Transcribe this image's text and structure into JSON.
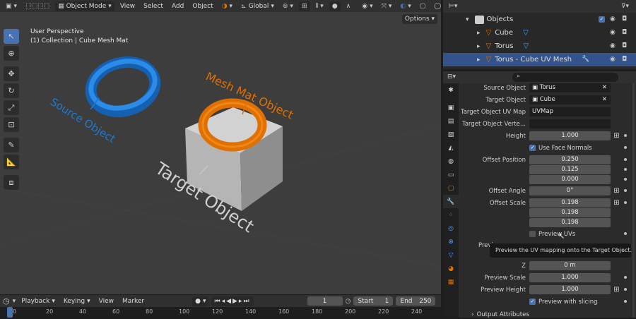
{
  "viewport_header": {
    "mode": "Object Mode",
    "menu": [
      "View",
      "Select",
      "Add",
      "Object"
    ],
    "orientation": "Global",
    "options": "Options"
  },
  "viewport": {
    "perspective": "User Perspective",
    "collection": "(1) Collection | Cube Mesh Mat",
    "labels": {
      "source": "Source Object",
      "mesh_mat": "Mesh Mat Object",
      "target": "Target Object"
    }
  },
  "outliner": {
    "title": "Objects",
    "items": [
      {
        "name": "Cube",
        "selected": false
      },
      {
        "name": "Torus",
        "selected": false
      },
      {
        "name": "Torus - Cube UV Mesh",
        "selected": true
      }
    ]
  },
  "properties": {
    "source_object": {
      "label": "Source Object",
      "value": "Torus"
    },
    "target_object": {
      "label": "Target Object",
      "value": "Cube"
    },
    "target_uv_map": {
      "label": "Target Object UV Map",
      "value": "UVMap"
    },
    "target_vertex": {
      "label": "Target Object Verte...",
      "value": ""
    },
    "height": {
      "label": "Height",
      "value": "1.000"
    },
    "use_face_normals": {
      "label": "Use Face Normals",
      "checked": true
    },
    "offset_position": {
      "label": "Offset Position",
      "values": [
        "0.250",
        "0.125",
        "0.000"
      ]
    },
    "offset_angle": {
      "label": "Offset Angle",
      "value": "0°"
    },
    "offset_scale": {
      "label": "Offset Scale",
      "values": [
        "0.198",
        "0.198",
        "0.198"
      ]
    },
    "preview_uvs": {
      "label": "Preview UVs",
      "checked": false
    },
    "preview_label_partial": "Previ",
    "z": {
      "label": "Z",
      "value": "0 m"
    },
    "preview_scale": {
      "label": "Preview Scale",
      "value": "1.000"
    },
    "preview_height": {
      "label": "Preview Height",
      "value": "1.000"
    },
    "preview_slicing": {
      "label": "Preview with slicing",
      "checked": true
    },
    "output_attributes": "Output Attributes",
    "tooltip": "Preview the UV mapping onto the Target Object."
  },
  "timeline": {
    "menu": [
      "Playback",
      "Keying",
      "View",
      "Marker"
    ],
    "current_frame": "1",
    "start_label": "Start",
    "start": "1",
    "end_label": "End",
    "end": "250",
    "ticks": [
      "0",
      "20",
      "40",
      "60",
      "80",
      "100",
      "120",
      "140",
      "160",
      "180",
      "200",
      "220",
      "240"
    ]
  },
  "colors": {
    "accent": "#4772b3",
    "source": "#1f7ad1",
    "mesh_mat": "#e07000",
    "target_label": "#c8c8c8"
  }
}
